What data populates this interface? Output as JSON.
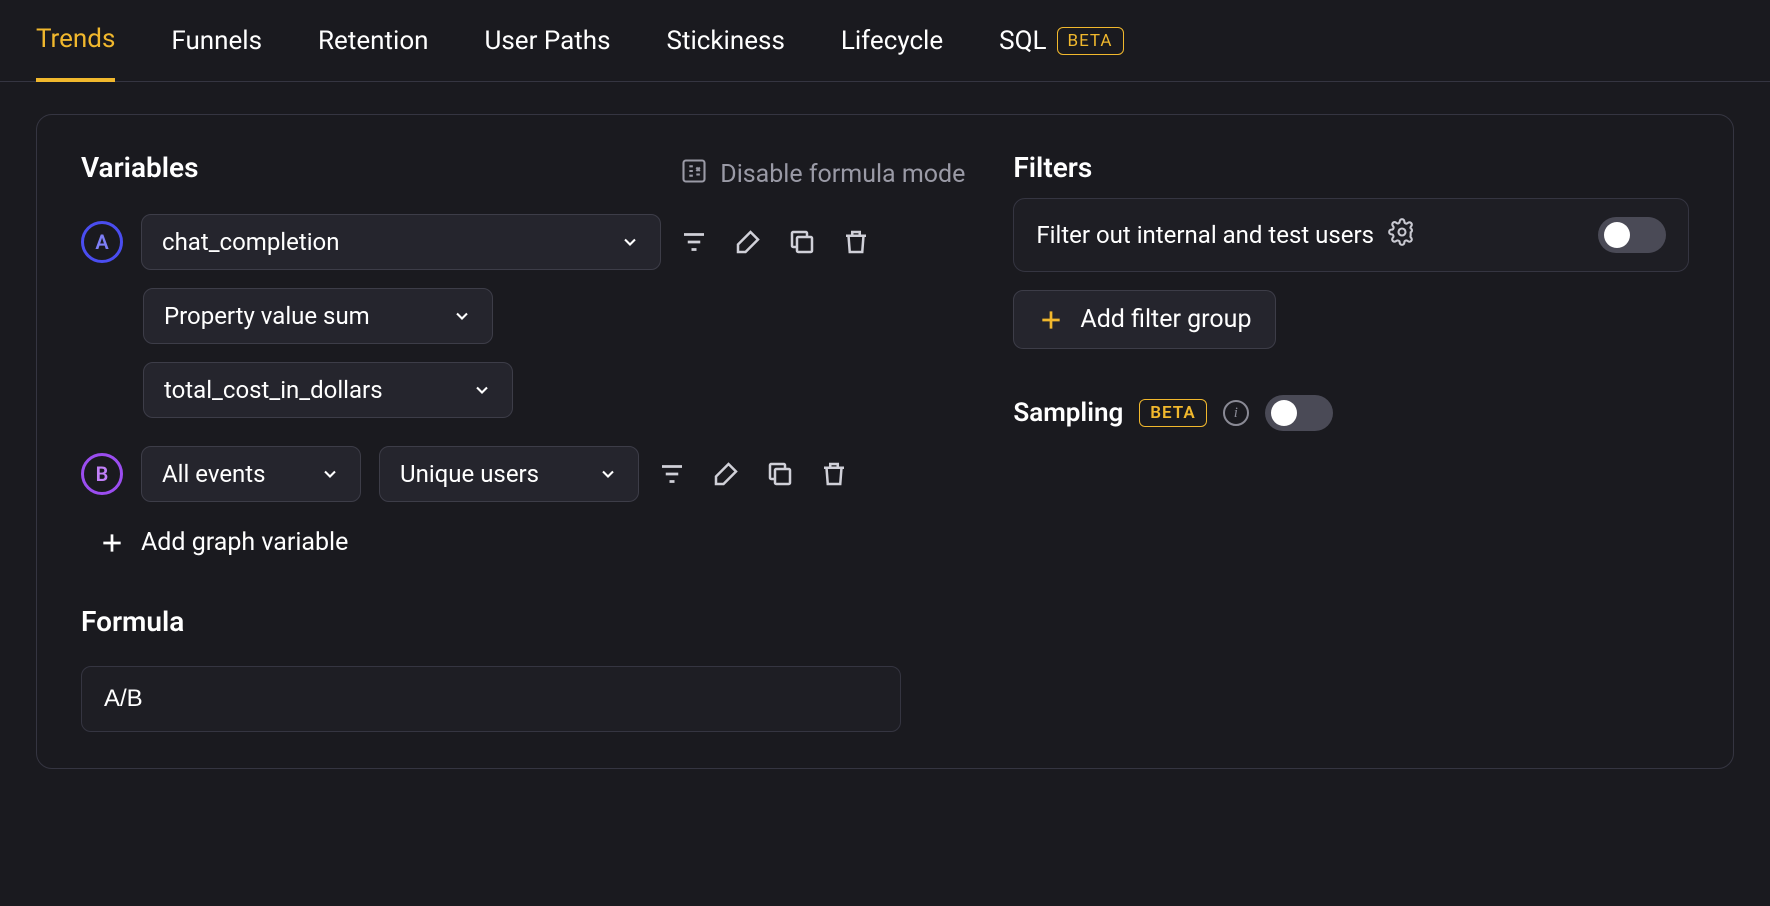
{
  "tabs": {
    "trends": "Trends",
    "funnels": "Funnels",
    "retention": "Retention",
    "user_paths": "User Paths",
    "stickiness": "Stickiness",
    "lifecycle": "Lifecycle",
    "sql": "SQL",
    "sql_badge": "BETA"
  },
  "variables": {
    "heading": "Variables",
    "disable_formula_label": "Disable formula mode",
    "a": {
      "letter": "A",
      "event": "chat_completion",
      "aggregation": "Property value sum",
      "property": "total_cost_in_dollars"
    },
    "b": {
      "letter": "B",
      "event": "All events",
      "aggregation": "Unique users"
    },
    "add_label": "Add graph variable"
  },
  "formula": {
    "heading": "Formula",
    "value": "A/B"
  },
  "filters": {
    "heading": "Filters",
    "internal_label": "Filter out internal and test users",
    "add_group_label": "Add filter group"
  },
  "sampling": {
    "label": "Sampling",
    "badge": "BETA"
  }
}
